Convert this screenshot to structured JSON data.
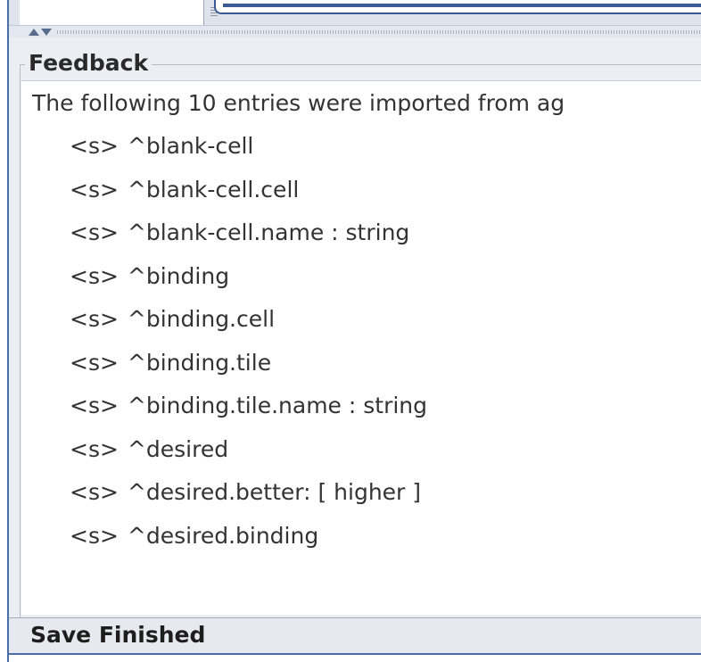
{
  "feedback": {
    "title": "Feedback",
    "intro": "The following 10 entries were imported from ag",
    "entries": [
      {
        "tag": "<s>",
        "text": "^blank-cell"
      },
      {
        "tag": "<s>",
        "text": "^blank-cell.cell"
      },
      {
        "tag": "<s>",
        "text": "^blank-cell.name : string"
      },
      {
        "tag": "<s>",
        "text": "^binding"
      },
      {
        "tag": "<s>",
        "text": "^binding.cell"
      },
      {
        "tag": "<s>",
        "text": "^binding.tile"
      },
      {
        "tag": "<s>",
        "text": "^binding.tile.name : string"
      },
      {
        "tag": "<s>",
        "text": "^desired"
      },
      {
        "tag": "<s>",
        "text": "^desired.better: [ higher ]"
      },
      {
        "tag": "<s>",
        "text": "^desired.binding"
      }
    ]
  },
  "status": {
    "text": "Save Finished"
  },
  "icons": {
    "split_up": "arrow-up-icon",
    "split_down": "arrow-down-icon"
  },
  "colors": {
    "accent": "#3b5b95",
    "panel_bg": "#ebeef3",
    "text": "#333333"
  }
}
